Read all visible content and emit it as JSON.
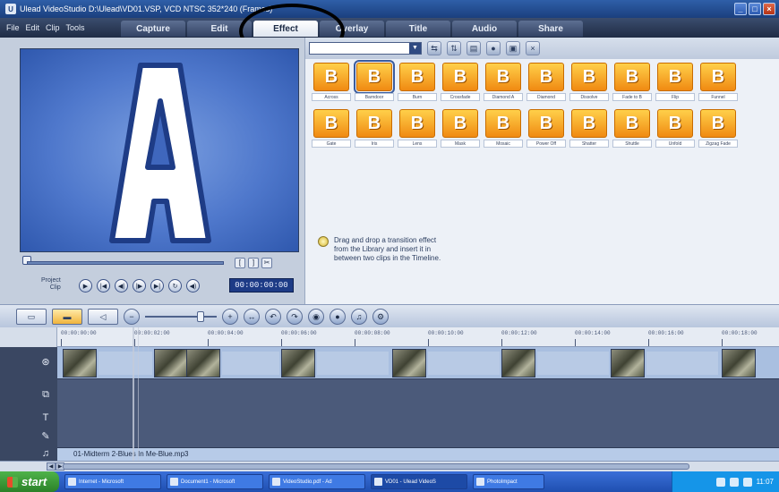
{
  "window": {
    "title": "Ulead VideoStudio D:\\Ulead\\VD01.VSP, VCD NTSC 352*240 (Frames)",
    "app_icon": "ulead-icon",
    "controls": [
      "minimize",
      "maximize",
      "close"
    ]
  },
  "menu": [
    "File",
    "Edit",
    "Clip",
    "Tools"
  ],
  "steps": [
    {
      "label": "Capture",
      "active": false
    },
    {
      "label": "Edit",
      "active": false
    },
    {
      "label": "Effect",
      "active": true
    },
    {
      "label": "Overlay",
      "active": false
    },
    {
      "label": "Title",
      "active": false
    },
    {
      "label": "Audio",
      "active": false
    },
    {
      "label": "Share",
      "active": false
    }
  ],
  "preview": {
    "letter": "A",
    "project_label": "Project",
    "clip_label": "Clip",
    "timecode": "00:00:00:00"
  },
  "library": {
    "category": "",
    "effects": [
      {
        "label": "Across",
        "selected": false
      },
      {
        "label": "Barndoor",
        "selected": true
      },
      {
        "label": "Burn",
        "selected": false
      },
      {
        "label": "Crossfade",
        "selected": false
      },
      {
        "label": "Diamond A",
        "selected": false
      },
      {
        "label": "Diamond",
        "selected": false
      },
      {
        "label": "Dissolve",
        "selected": false
      },
      {
        "label": "Fade to B",
        "selected": false
      },
      {
        "label": "Flip",
        "selected": false
      },
      {
        "label": "Funnel",
        "selected": false
      },
      {
        "label": "Gate",
        "selected": false
      },
      {
        "label": "Iris",
        "selected": false
      },
      {
        "label": "Lens",
        "selected": false
      },
      {
        "label": "Mask",
        "selected": false
      },
      {
        "label": "Mosaic",
        "selected": false
      },
      {
        "label": "Power Off",
        "selected": false
      },
      {
        "label": "Shatter",
        "selected": false
      },
      {
        "label": "Shuttle",
        "selected": false
      },
      {
        "label": "Unfold",
        "selected": false
      },
      {
        "label": "Zigzag Fade",
        "selected": false
      }
    ],
    "hint": "Drag and drop a transition effect from the Library and insert it in between two clips in the Timeline."
  },
  "timeline": {
    "ruler": [
      "00:00:00:00",
      "00:00:02:00",
      "00:00:04:00",
      "00:00:06:00",
      "00:00:08:00",
      "00:00:10:00",
      "00:00:12:00",
      "00:00:14:00",
      "00:00:16:00",
      "00:00:18:00"
    ],
    "audio_clip": "01-Midterm 2-Blues In Me-Blue.mp3",
    "tracks": [
      "video-track",
      "overlay-track",
      "title-track",
      "voice-track",
      "music-track"
    ]
  },
  "taskbar": {
    "start_label": "start",
    "tasks": [
      {
        "label": "Internet - Microsoft",
        "active": false
      },
      {
        "label": "Document1 - Microsoft",
        "active": false
      },
      {
        "label": "VideoStudio.pdf - Ad",
        "active": false
      },
      {
        "label": "VD01 - Ulead VideoS",
        "active": true
      },
      {
        "label": "PhotoImpact",
        "active": false
      }
    ],
    "clock": "11:07"
  },
  "colors": {
    "titlebar": "#1b3f7e",
    "stepbar": "#2a3957",
    "accent": "#f08a12",
    "preview_bg": "#4f78cc"
  }
}
